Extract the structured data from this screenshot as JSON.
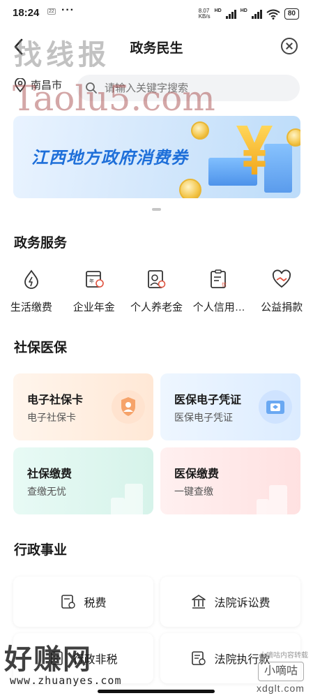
{
  "status_bar": {
    "time": "18:24",
    "sim_badge": "22",
    "more": "···",
    "net_speed": "8.07",
    "net_unit": "KB/s",
    "hd1": "HD",
    "hd2": "HD",
    "battery": "80"
  },
  "header": {
    "title": "政务民生"
  },
  "location": {
    "city": "南昌市"
  },
  "search": {
    "placeholder": "请输入关键字搜索"
  },
  "banner": {
    "text": "江西地方政府消费券"
  },
  "gov_services": {
    "title": "政务服务",
    "items": [
      {
        "label": "生活缴费",
        "icon": "drop-bolt-icon"
      },
      {
        "label": "企业年金",
        "icon": "calendar-coin-icon"
      },
      {
        "label": "个人养老金",
        "icon": "person-card-icon"
      },
      {
        "label": "个人信用…",
        "icon": "credit-doc-icon"
      },
      {
        "label": "公益捐款",
        "icon": "heart-hands-icon"
      }
    ]
  },
  "social_security": {
    "title": "社保医保",
    "cards": [
      {
        "title": "电子社保卡",
        "subtitle": "电子社保卡",
        "icon": "shield-person-icon"
      },
      {
        "title": "医保电子凭证",
        "subtitle": "医保电子凭证",
        "icon": "card-icon"
      },
      {
        "title": "社保缴费",
        "subtitle": "查缴无忧"
      },
      {
        "title": "医保缴费",
        "subtitle": "一键查缴"
      }
    ]
  },
  "admin": {
    "title": "行政事业",
    "items": [
      {
        "label": "税费",
        "icon": "tax-doc-icon"
      },
      {
        "label": "法院诉讼费",
        "icon": "courthouse-icon"
      },
      {
        "label": "行政非税",
        "icon": "admin-doc-icon"
      },
      {
        "label": "法院执行款",
        "icon": "court-doc-icon"
      }
    ]
  },
  "watermarks": {
    "top_cn": "找线报",
    "top_en": "Taolu5.com",
    "bottom_cn": "好赚网",
    "bottom_url": "www.zhuanyes.com",
    "corner_small": "小嘀咕",
    "corner_small_top": "小嘀咕内容转载",
    "corner_url": "xdglt.com"
  }
}
